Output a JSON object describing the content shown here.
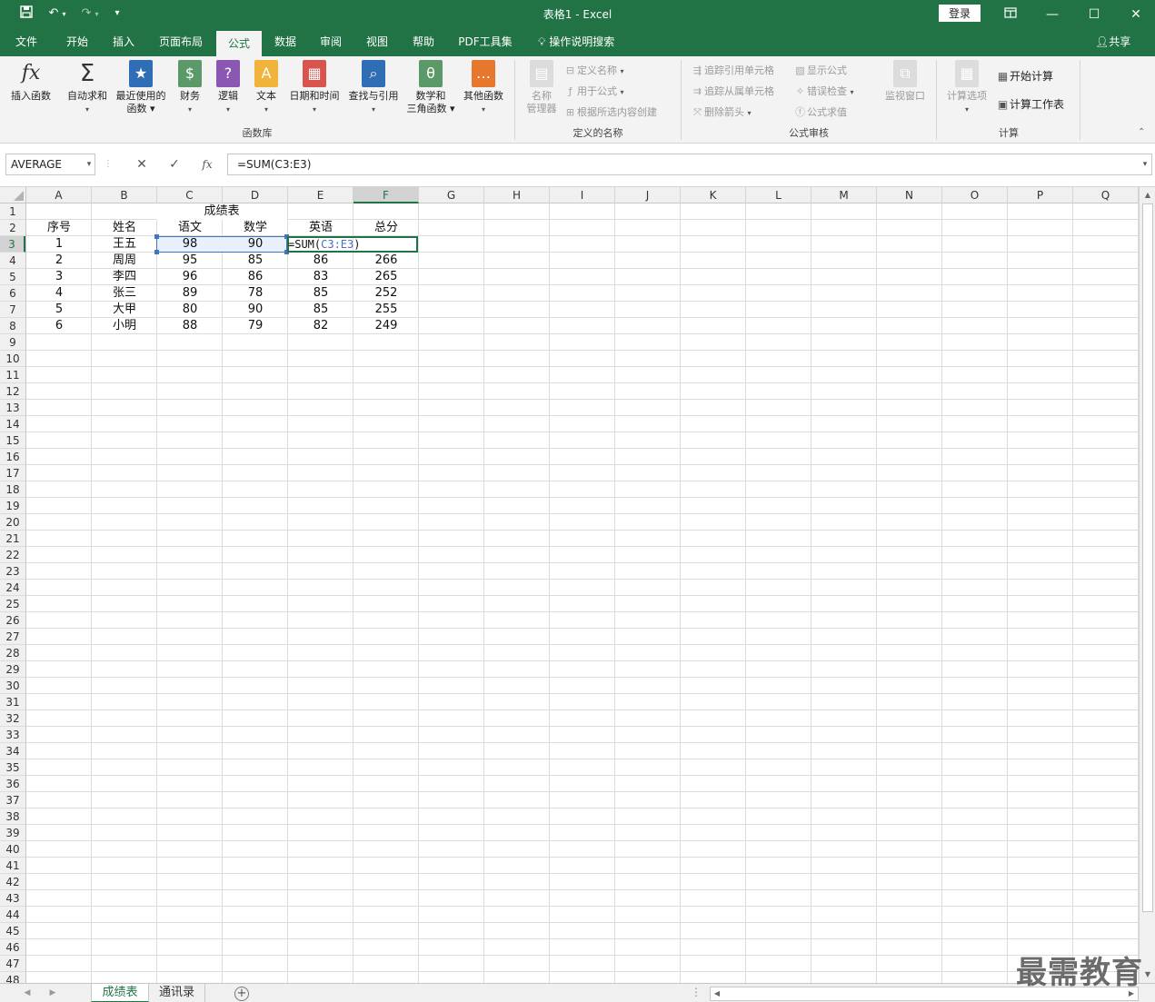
{
  "window": {
    "title": "表格1  -  Excel",
    "login_label": "登录",
    "quick_access": {
      "save_icon": "save-icon",
      "undo_icon": "undo-icon",
      "redo_icon": "redo-icon",
      "customize_icon": "customize-qat-icon"
    },
    "buttons": [
      "ribbon-display-icon",
      "minimize-icon",
      "maximize-icon",
      "close-icon"
    ]
  },
  "tabs": [
    "文件",
    "开始",
    "插入",
    "页面布局",
    "公式",
    "数据",
    "审阅",
    "视图",
    "帮助",
    "PDF工具集"
  ],
  "active_tab": "公式",
  "tell_me": "操作说明搜索",
  "share": "共享",
  "ribbon": {
    "function_library": {
      "label": "函数库",
      "buttons": [
        {
          "l1": "插入函数",
          "l2": "",
          "icon": "fx"
        },
        {
          "l1": "自动求和",
          "l2": "▾",
          "icon": "Σ"
        },
        {
          "l1": "最近使用的",
          "l2": "函数 ▾",
          "icon": "★"
        },
        {
          "l1": "财务",
          "l2": "▾",
          "icon": "$"
        },
        {
          "l1": "逻辑",
          "l2": "▾",
          "icon": "?"
        },
        {
          "l1": "文本",
          "l2": "▾",
          "icon": "A"
        },
        {
          "l1": "日期和时间",
          "l2": "▾",
          "icon": "▦"
        },
        {
          "l1": "查找与引用",
          "l2": "▾",
          "icon": "⌕"
        },
        {
          "l1": "数学和",
          "l2": "三角函数 ▾",
          "icon": "θ"
        },
        {
          "l1": "其他函数",
          "l2": "▾",
          "icon": "…"
        }
      ]
    },
    "defined_names": {
      "label": "定义的名称",
      "manager_l1": "名称",
      "manager_l2": "管理器",
      "items": [
        "定义名称",
        "用于公式",
        "根据所选内容创建"
      ]
    },
    "formula_auditing": {
      "label": "公式审核",
      "items_left": [
        "追踪引用单元格",
        "追踪从属单元格",
        "删除箭头"
      ],
      "items_right": [
        "显示公式",
        "错误检查",
        "公式求值"
      ],
      "watch_window": "监视窗口"
    },
    "calculation": {
      "label": "计算",
      "options": "计算选项",
      "calc_now": "开始计算",
      "calc_sheet": "计算工作表"
    }
  },
  "formula_bar": {
    "name_box": "AVERAGE",
    "cancel": "✕",
    "enter": "✓",
    "fx": "fx",
    "formula": "=SUM(C3:E3)"
  },
  "columns": [
    "A",
    "B",
    "C",
    "D",
    "E",
    "F",
    "G",
    "H",
    "I",
    "J",
    "K",
    "L",
    "M",
    "N",
    "O",
    "P",
    "Q"
  ],
  "selected_column": "F",
  "row_count": 48,
  "selected_row": 3,
  "sheet": {
    "title": "成绩表",
    "headers": [
      "序号",
      "姓名",
      "语文",
      "数学",
      "英语",
      "总分"
    ],
    "rows": [
      [
        "1",
        "王五",
        "98",
        "90",
        "",
        ""
      ],
      [
        "2",
        "周周",
        "95",
        "85",
        "86",
        "266"
      ],
      [
        "3",
        "李四",
        "96",
        "86",
        "83",
        "265"
      ],
      [
        "4",
        "张三",
        "89",
        "78",
        "85",
        "252"
      ],
      [
        "5",
        "大甲",
        "80",
        "90",
        "85",
        "255"
      ],
      [
        "6",
        "小明",
        "88",
        "79",
        "82",
        "249"
      ]
    ],
    "editing_formula_prefix": "=SUM(",
    "editing_formula_ref": "C3:E3",
    "editing_formula_suffix": ")"
  },
  "sheet_tabs": [
    "成绩表",
    "通讯录"
  ],
  "active_sheet": "成绩表",
  "watermark": "最需教育",
  "colors": {
    "accent": "#217346",
    "ref_blue": "#4472c4"
  }
}
